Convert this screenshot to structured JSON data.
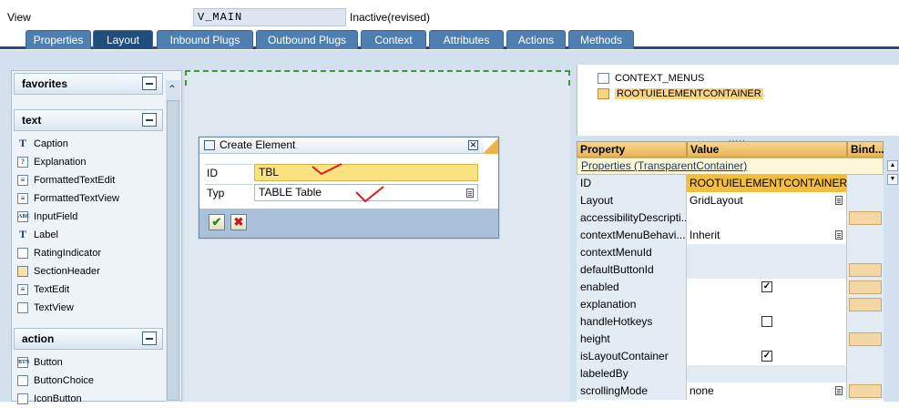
{
  "header": {
    "view_label": "View",
    "view_value": "V_MAIN",
    "status": "Inactive(revised)"
  },
  "tabs": [
    {
      "label": "Properties"
    },
    {
      "label": "Layout"
    },
    {
      "label": "Inbound Plugs"
    },
    {
      "label": "Outbound Plugs"
    },
    {
      "label": "Context"
    },
    {
      "label": "Attributes"
    },
    {
      "label": "Actions"
    },
    {
      "label": "Methods"
    }
  ],
  "palette": {
    "favorites": "favorites",
    "text_group": "text",
    "text_items": [
      "Caption",
      "Explanation",
      "FormattedTextEdit",
      "FormattedTextView",
      "InputField",
      "Label",
      "RatingIndicator",
      "SectionHeader",
      "TextEdit",
      "TextView"
    ],
    "action_group": "action",
    "action_items": [
      "Button",
      "ButtonChoice",
      "IconButton"
    ]
  },
  "dialog": {
    "title": "Create Element",
    "id_label": "ID",
    "id_value": "TBL",
    "type_label": "Typ",
    "type_value": "TABLE Table",
    "ok_symbol": "✔",
    "cancel_symbol": "✖"
  },
  "tree": {
    "items": [
      "CONTEXT_MENUS",
      "ROOTUIELEMENTCONTAINER"
    ]
  },
  "properties": {
    "col_property": "Property",
    "col_value": "Value",
    "col_bind": "Bind...",
    "section": "Properties (TransparentContainer)",
    "rows": [
      {
        "name": "ID",
        "value": "ROOTUIELEMENTCONTAINER"
      },
      {
        "name": "Layout",
        "value": "GridLayout"
      },
      {
        "name": "accessibilityDescripti...",
        "value": ""
      },
      {
        "name": "contextMenuBehavi...",
        "value": "Inherit"
      },
      {
        "name": "contextMenuId",
        "value": ""
      },
      {
        "name": "defaultButtonId",
        "value": ""
      },
      {
        "name": "enabled",
        "value": "✓"
      },
      {
        "name": "explanation",
        "value": ""
      },
      {
        "name": "handleHotkeys",
        "value": ""
      },
      {
        "name": "height",
        "value": ""
      },
      {
        "name": "isLayoutContainer",
        "value": "✓"
      },
      {
        "name": "labeledBy",
        "value": ""
      },
      {
        "name": "scrollingMode",
        "value": "none"
      }
    ]
  },
  "colors": {
    "tab_active": "#1f4e7d",
    "tab": "#4f7fb0",
    "highlight": "#f3bd3d",
    "header_gold": "#e8b457"
  }
}
